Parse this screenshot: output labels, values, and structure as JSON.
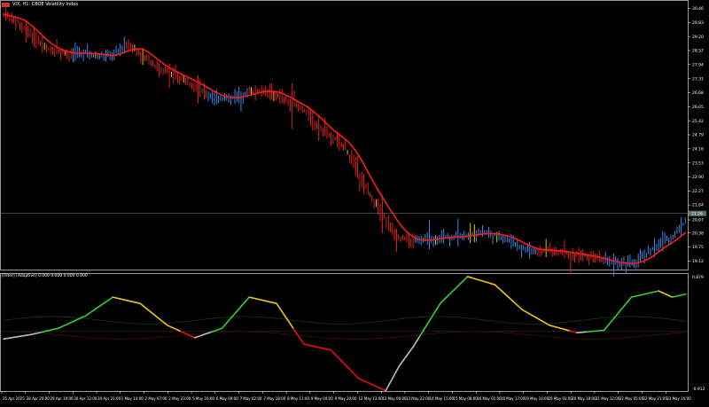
{
  "window": {
    "symbol_label": "VIX, H1:  CBOE Volatility Index",
    "indicator_label": "[Filter] [Adaptive] 0.000 0.000 0.000 0.000"
  },
  "colors": {
    "background": "#000000",
    "axis": "#ffffff",
    "bar_up": "#3399ff",
    "bar_down": "#ff2020",
    "bar_neutral": "#ffd700",
    "ma": "#ff1a1a",
    "ma_blue": "#1e90ff",
    "osc_green": "#33cc33",
    "osc_yellow": "#e6c619",
    "osc_red": "#e01010",
    "osc_gray": "#bbbbbb",
    "price_line": "#6d8a8a"
  },
  "price_axis": {
    "ticks": [
      "30.46",
      "29.83",
      "29.20",
      "28.57",
      "27.94",
      "27.31",
      "26.68",
      "26.05",
      "25.42",
      "24.79",
      "24.16",
      "23.53",
      "22.90",
      "22.27",
      "21.64",
      "20.97",
      "20.38",
      "19.75",
      "19.12"
    ],
    "current_price": "21.26"
  },
  "osc_axis": {
    "top": "0.879",
    "bottom": "-0.912"
  },
  "time_axis": {
    "labels": [
      "25 Apr 2025",
      "28 Apr 20:00",
      "29 Apr 19:00",
      "30 Apr 12:00",
      "30 Apr 21:00",
      "1 May 14:00",
      "2 May 07:00",
      "2 May 23:00",
      "5 May 16:00",
      "6 May 09:00",
      "7 May 02:00",
      "7 May 18:00",
      "8 May 11:00",
      "9 May 04:00",
      "9 May 20:00",
      "12 May 13:00",
      "13 May 06:00",
      "13 May 22:00",
      "14 May 15:00",
      "15 May 08:00",
      "16 May 01:00",
      "16 May 17:00",
      "19 May 10:00",
      "20 May 03:00",
      "20 May 19:00",
      "21 May 12:00",
      "22 May 05:00",
      "22 May 21:00",
      "23 May 14:00"
    ]
  },
  "chart_data": [
    {
      "type": "line",
      "title": "VIX, H1:  CBOE Volatility Index",
      "series": [
        {
          "name": "VIX",
          "x_index": [
            0,
            4,
            8,
            12,
            16,
            20,
            24,
            28,
            32,
            36,
            40,
            44,
            48,
            52,
            56,
            60,
            64,
            68,
            72,
            76,
            80,
            84,
            88,
            92,
            96,
            100,
            104,
            108,
            112,
            116,
            120,
            124,
            128,
            132,
            136,
            140,
            144,
            148,
            152,
            156,
            160,
            164,
            168,
            172,
            176,
            180,
            184,
            188,
            192,
            196,
            200
          ],
          "values": [
            30.2,
            29.9,
            29.3,
            28.7,
            28.5,
            28.4,
            28.5,
            28.3,
            28.4,
            28.8,
            28.5,
            27.9,
            27.6,
            27.3,
            27.0,
            26.6,
            26.4,
            26.5,
            26.7,
            26.8,
            26.6,
            26.2,
            25.9,
            25.2,
            24.7,
            24.3,
            23.0,
            22.0,
            21.0,
            20.2,
            20.0,
            20.1,
            20.2,
            20.2,
            20.3,
            20.4,
            20.3,
            20.1,
            19.7,
            19.6,
            19.6,
            19.5,
            19.4,
            19.3,
            19.1,
            19.0,
            19.0,
            19.4,
            19.9,
            20.2,
            20.9
          ]
        }
      ],
      "ylim": [
        18.9,
        30.6
      ]
    },
    {
      "type": "line",
      "title": "[Filter] [Adaptive] 0.000 0.000 0.000 0.000",
      "series": [
        {
          "name": "Filter",
          "x_index": [
            0,
            8,
            16,
            24,
            32,
            40,
            48,
            56,
            64,
            72,
            80,
            88,
            96,
            104,
            112,
            116,
            120,
            128,
            136,
            144,
            152,
            160,
            168,
            176,
            184,
            192,
            196,
            200
          ],
          "values": [
            -0.12,
            -0.05,
            0.05,
            0.25,
            0.55,
            0.45,
            0.1,
            -0.1,
            0.05,
            0.55,
            0.45,
            -0.2,
            -0.3,
            -0.75,
            -0.95,
            -0.55,
            -0.25,
            0.45,
            0.88,
            0.75,
            0.35,
            0.1,
            -0.02,
            0.02,
            0.55,
            0.65,
            0.55,
            0.6
          ]
        }
      ],
      "ylim": [
        -0.912,
        0.879
      ]
    }
  ]
}
